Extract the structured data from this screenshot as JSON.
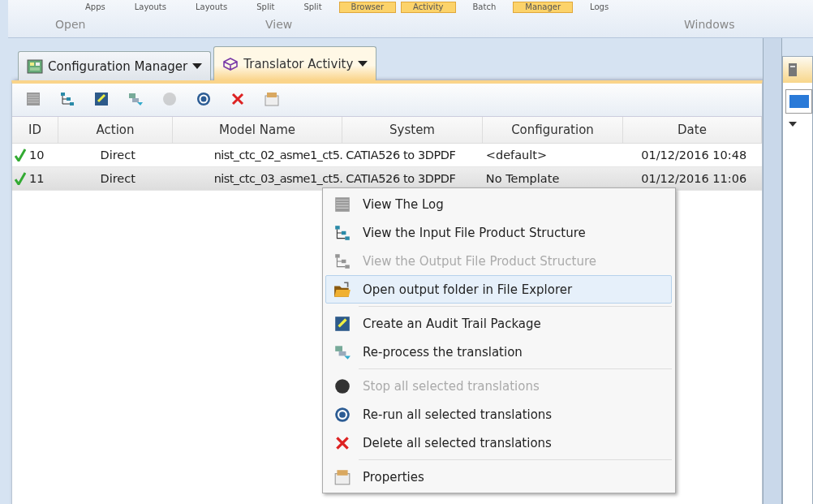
{
  "ribbon": {
    "buttons": [
      {
        "label": "Apps",
        "selected": false
      },
      {
        "label": "Layouts",
        "selected": false
      },
      {
        "label": "Layouts",
        "selected": false
      },
      {
        "label": "Split",
        "selected": false
      },
      {
        "label": "Split",
        "selected": false
      },
      {
        "label": "Browser",
        "selected": true
      },
      {
        "label": "Activity",
        "selected": true
      },
      {
        "label": "Batch",
        "selected": false
      },
      {
        "label": "Manager",
        "selected": true
      },
      {
        "label": "Logs",
        "selected": false
      }
    ],
    "groups": [
      "Open",
      "View",
      "Windows"
    ]
  },
  "tabs": [
    {
      "label": "Configuration Manager",
      "selected": false
    },
    {
      "label": "Translator Activity",
      "selected": true
    }
  ],
  "toolbar": [
    {
      "disabled": false
    },
    {
      "disabled": false
    },
    {
      "disabled": false
    },
    {
      "disabled": false
    },
    {
      "disabled": true
    },
    {
      "disabled": false
    },
    {
      "disabled": false
    },
    {
      "disabled": false
    }
  ],
  "table": {
    "columns": [
      "ID",
      "Action",
      "Model Name",
      "System",
      "Configuration",
      "Date"
    ],
    "rows": [
      {
        "done": true,
        "selected": false,
        "cells": [
          "10",
          "Direct",
          "nist_ctc_02_asme1_ct5.",
          "CATIA526 to 3DPDF",
          "<default>",
          "01/12/2016 10:48"
        ]
      },
      {
        "done": true,
        "selected": true,
        "cells": [
          "11",
          "Direct",
          "nist_ctc_03_asme1_ct5.",
          "CATIA526 to 3DPDF",
          "No Template",
          "01/12/2016 11:06"
        ]
      }
    ]
  },
  "context_menu": [
    {
      "label": "View The Log",
      "disabled": false,
      "selected": false
    },
    {
      "label": "View the Input File Product Structure",
      "disabled": false,
      "selected": false
    },
    {
      "label": "View the Output File Product Structure",
      "disabled": true,
      "selected": false
    },
    {
      "label": "Open output folder in File Explorer",
      "disabled": false,
      "selected": true
    },
    {
      "label": "Create an Audit Trail Package",
      "disabled": false,
      "selected": false
    },
    {
      "label": "Re-process the translation",
      "disabled": false,
      "selected": false
    },
    {
      "label": "Stop all selected translations",
      "disabled": true,
      "selected": false
    },
    {
      "label": "Re-run all selected translations",
      "disabled": false,
      "selected": false
    },
    {
      "label": "Delete all selected translations",
      "disabled": false,
      "selected": false
    },
    {
      "label": "Properties",
      "disabled": false,
      "selected": false
    }
  ]
}
